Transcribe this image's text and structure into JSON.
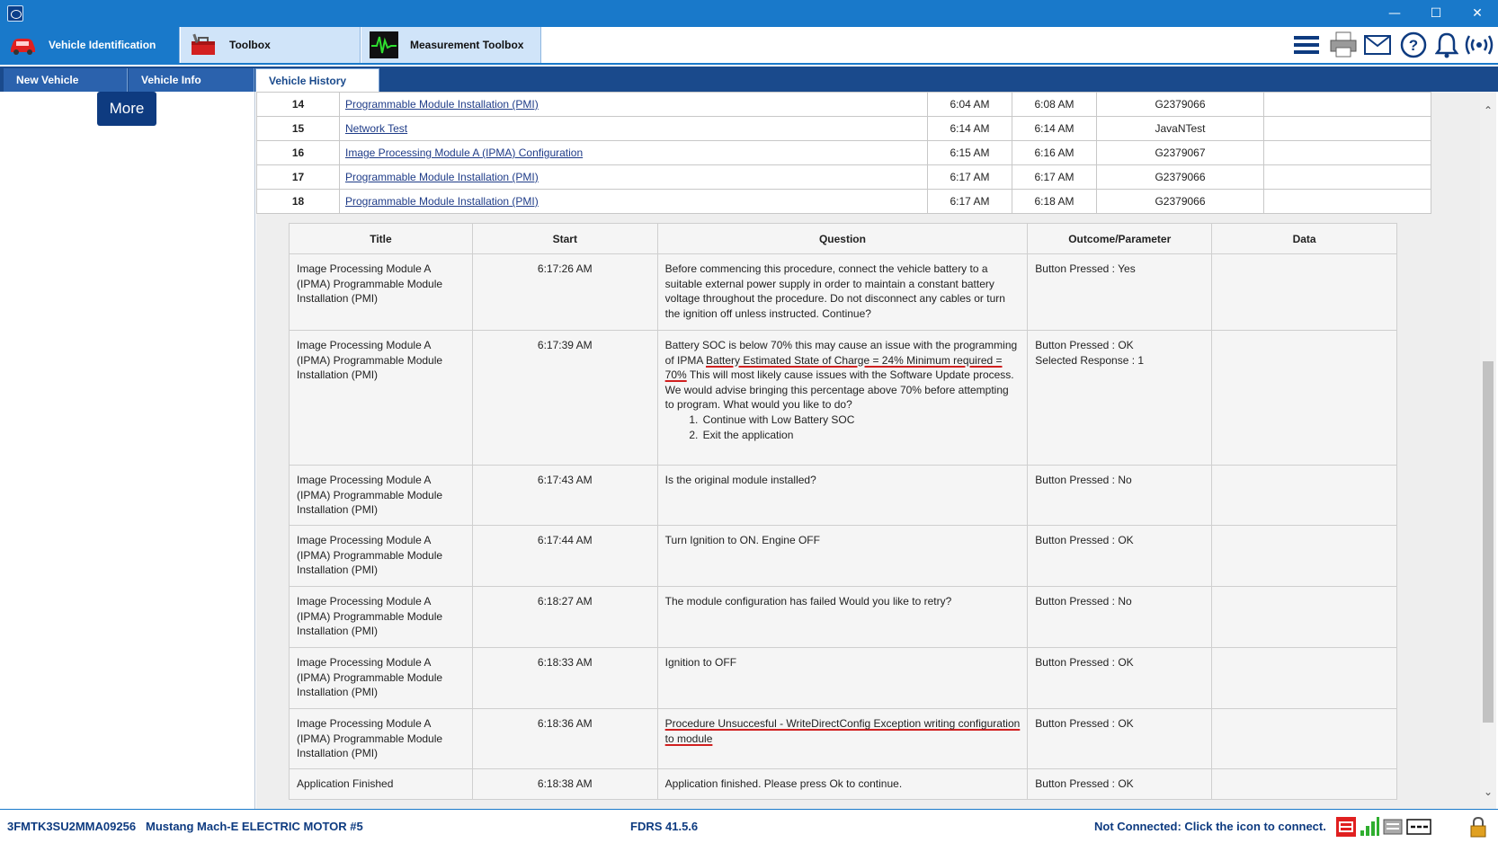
{
  "window": {
    "minimize": "—",
    "maximize": "☐",
    "close": "✕"
  },
  "toolbar": {
    "tabs": [
      {
        "label": "Vehicle Identification",
        "icon": "car-icon"
      },
      {
        "label": "Toolbox",
        "icon": "toolbox-icon"
      },
      {
        "label": "Measurement Toolbox",
        "icon": "waveform-icon"
      }
    ],
    "right_icons": [
      "menu-icon",
      "printer-icon",
      "mail-icon",
      "help-icon",
      "bell-icon",
      "wireless-icon"
    ]
  },
  "subtabs": [
    "New Vehicle",
    "Vehicle Info",
    "Vehicle History"
  ],
  "left": {
    "more_label": "More"
  },
  "history": {
    "rows": [
      {
        "num": "14",
        "name": "Programmable Module Installation (PMI)",
        "start": "6:04 AM",
        "end": "6:08 AM",
        "tool": "G2379066"
      },
      {
        "num": "15",
        "name": "Network Test",
        "start": "6:14 AM",
        "end": "6:14 AM",
        "tool": "JavaNTest"
      },
      {
        "num": "16",
        "name": "Image Processing Module A (IPMA) Configuration",
        "start": "6:15 AM",
        "end": "6:16 AM",
        "tool": "G2379067"
      },
      {
        "num": "17",
        "name": "Programmable Module Installation (PMI)",
        "start": "6:17 AM",
        "end": "6:17 AM",
        "tool": "G2379066"
      },
      {
        "num": "18",
        "name": "Programmable Module Installation (PMI)",
        "start": "6:17 AM",
        "end": "6:18 AM",
        "tool": "G2379066"
      }
    ]
  },
  "steps": {
    "headers": [
      "Title",
      "Start",
      "Question",
      "Outcome/Parameter",
      "Data"
    ],
    "rows": [
      {
        "title": "Image Processing Module A (IPMA) Programmable Module Installation (PMI)",
        "start": "6:17:26 AM",
        "question": "Before commencing this procedure, connect the vehicle battery to a suitable external power supply in order to maintain a constant battery voltage throughout the procedure. Do not disconnect any cables or turn the ignition off unless instructed. Continue?",
        "outcome": "Button Pressed : Yes"
      },
      {
        "title": "Image Processing Module A (IPMA) Programmable Module Installation (PMI)",
        "start": "6:17:39 AM",
        "question_a": "Battery SOC is below 70% this may cause an issue with the programming of IPMA ",
        "question_underlined": "Battery Estimated State of Charge = 24% Minimum required = 70%",
        "question_b": " This will most likely cause issues with the Software Update process. We would advise bringing this percentage above 70% before attempting to program. What would you like to do?",
        "options": [
          "Continue with Low Battery SOC",
          "Exit the application"
        ],
        "outcome": "Button Pressed : OK",
        "outcome2": "Selected Response : 1"
      },
      {
        "title": "Image Processing Module A (IPMA) Programmable Module Installation (PMI)",
        "start": "6:17:43 AM",
        "question": "Is the original module installed?",
        "outcome": "Button Pressed : No"
      },
      {
        "title": "Image Processing Module A (IPMA) Programmable Module Installation (PMI)",
        "start": "6:17:44 AM",
        "question": "Turn Ignition to ON. Engine OFF",
        "outcome": "Button Pressed : OK"
      },
      {
        "title": "Image Processing Module A (IPMA) Programmable Module Installation (PMI)",
        "start": "6:18:27 AM",
        "question": "The module configuration has failed Would you like to retry?",
        "outcome": "Button Pressed : No"
      },
      {
        "title": "Image Processing Module A (IPMA) Programmable Module Installation (PMI)",
        "start": "6:18:33 AM",
        "question": "Ignition to OFF",
        "outcome": "Button Pressed : OK"
      },
      {
        "title": "Image Processing Module A (IPMA) Programmable Module Installation (PMI)",
        "start": "6:18:36 AM",
        "question": "Procedure Unsuccesful - WriteDirectConfig Exception writing configuration to module",
        "outcome": "Button Pressed : OK"
      },
      {
        "title": "Application Finished",
        "start": "6:18:38 AM",
        "question": "Application finished. Please press Ok to continue.",
        "outcome": "Button Pressed : OK"
      }
    ]
  },
  "status": {
    "vin": "3FMTK3SU2MMA09256",
    "vehicle": "Mustang Mach-E ELECTRIC MOTOR #5",
    "version": "FDRS 41.5.6",
    "connection": "Not Connected: Click the icon to connect."
  },
  "colors": {
    "accent": "#1979ca",
    "navy": "#0e3b80",
    "annotation": "#d01f1f"
  }
}
